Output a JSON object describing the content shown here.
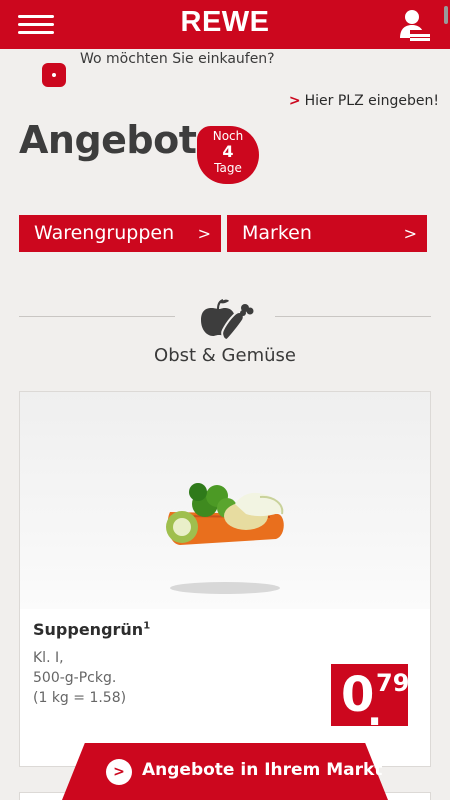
{
  "header": {
    "logo": "REWE",
    "menu_icon": "hamburger-menu-icon",
    "user_icon": "user-profile-icon",
    "brand_color": "#cc071e"
  },
  "location": {
    "question": "Wo möchten Sie einkaufen?",
    "plz_link_chevron": ">",
    "plz_link_label": "Hier PLZ eingeben!",
    "pin_icon": "location-pin-icon"
  },
  "page": {
    "title": "Angebote",
    "days_badge": {
      "line1": "Noch",
      "line2": "4",
      "line3": "Tage"
    }
  },
  "filters": {
    "warengruppen_label": "Warengruppen",
    "marken_label": "Marken",
    "arrow": ">"
  },
  "section": {
    "title": "Obst & Gemüse",
    "icon": "fruit-vegetable-icon"
  },
  "product": {
    "name": "Suppengrün",
    "footnote": "1",
    "detail_1": "Kl. I,",
    "detail_2": "500-g-Pckg.",
    "detail_3": "(1 kg = 1.58)",
    "price_euros": "0",
    "price_cents": "79"
  },
  "cta": {
    "label": "Angebote in Ihrem Markt",
    "icon_glyph": ">"
  }
}
